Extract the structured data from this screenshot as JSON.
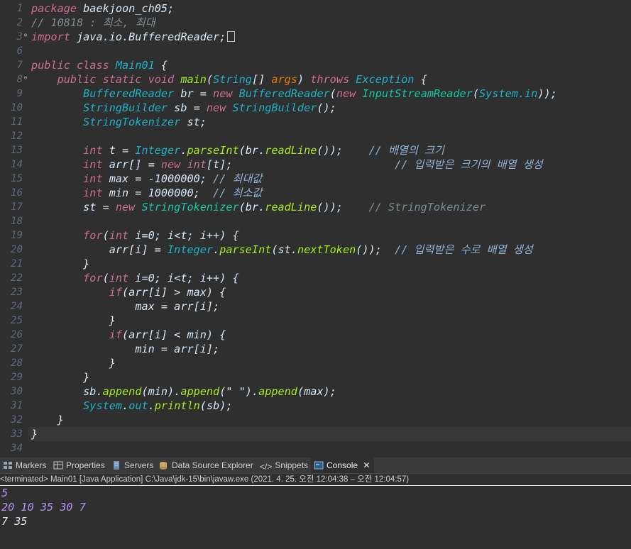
{
  "colors": {
    "background": "#2f2f2f",
    "keyword": "#cc6c93",
    "type": "#1fb2c6",
    "method": "#a7ec21",
    "comment": "#7d8c93",
    "input_text": "#b294f0",
    "output_text": "#d9e8f7"
  },
  "editor": {
    "line_numbers": [
      "1",
      "2",
      "3",
      "6",
      "7",
      "8",
      "9",
      "10",
      "11",
      "12",
      "13",
      "14",
      "15",
      "16",
      "17",
      "18",
      "19",
      "20",
      "21",
      "22",
      "23",
      "24",
      "25",
      "26",
      "27",
      "28",
      "29",
      "30",
      "31",
      "32",
      "33",
      "34"
    ],
    "lines": {
      "l1_kw": "package",
      "l1_rest": " baekjoon_ch05;",
      "l2": "// 10818 : 최소, 최대",
      "l3_kw": "import",
      "l3_rest": " java.io.BufferedReader;",
      "l7_kw1": "public",
      "l7_kw2": "class",
      "l7_name": "Main01",
      "l7_rest": " {",
      "l8_kw": "public static void",
      "l8_fn": "main",
      "l8_p1": "(",
      "l8_t1": "String",
      "l8_p2": "[] ",
      "l8_arg": "args",
      "l8_p3": ") ",
      "l8_throws": "throws",
      "l8_ex": "Exception",
      "l8_p4": " {",
      "l9_t": "BufferedReader",
      "l9_v": " br = ",
      "l9_new": "new",
      "l9_t2": "BufferedReader",
      "l9_p": "(",
      "l9_new2": "new",
      "l9_t3": "InputStreamReader",
      "l9_sys": "System",
      "l9_in": ".in",
      "l9_end": "));",
      "l10_t": "StringBuilder",
      "l10_v": " sb = ",
      "l10_new": "new",
      "l10_t2": "StringBuilder",
      "l10_end": "();",
      "l11_t": "StringTokenizer",
      "l11_v": " st;",
      "l13_int": "int",
      "l13_v": " t = ",
      "l13_t": "Integer",
      "l13_fn": "parseInt",
      "l13_br": "(br.",
      "l13_fn2": "readLine",
      "l13_end": "());",
      "l13_c": "// 배열의 크기",
      "l14_int": "int",
      "l14_v": " arr[] = ",
      "l14_new": "new",
      "l14_int2": "int",
      "l14_end": "[t];",
      "l14_c": "// 입력받은 크기의 배열 생성",
      "l15_int": "int",
      "l15_v": " max = -1000000; ",
      "l15_c": "// 최대값",
      "l16_int": "int",
      "l16_v": " min = 1000000;  ",
      "l16_c": "// 최소값",
      "l17_v": "st = ",
      "l17_new": "new",
      "l17_t": "StringTokenizer",
      "l17_br": "(br.",
      "l17_fn": "readLine",
      "l17_end": "());",
      "l17_c": "// StringTokenizer",
      "l19_for": "for",
      "l19_p": "(",
      "l19_int": "int",
      "l19_rest": " i=0; i<t; i++) {",
      "l20_v": "arr[i] = ",
      "l20_t": "Integer",
      "l20_fn": "parseInt",
      "l20_st": "(st.",
      "l20_fn2": "nextToken",
      "l20_end": "());  ",
      "l20_c": "// 입력받은 수로 배열 생성",
      "l21": "}",
      "l22_for": "for",
      "l22_p": "(",
      "l22_int": "int",
      "l22_rest": " i=0; i<t; i++) {",
      "l23_if": "if",
      "l23_rest": "(arr[i] > max) {",
      "l24": "max = arr[i];",
      "l25": "}",
      "l26_if": "if",
      "l26_rest": "(arr[i] < min) {",
      "l27": "min = arr[i];",
      "l28": "}",
      "l29": "}",
      "l30_v": "sb.",
      "l30_fn": "append",
      "l30_a": "(min).",
      "l30_fn2": "append",
      "l30_b": "(\" \").",
      "l30_fn3": "append",
      "l30_c": "(max);",
      "l31_sys": "System",
      "l31_dot": ".",
      "l31_out": "out",
      "l31_dot2": ".",
      "l31_fn": "println",
      "l31_end": "(sb);",
      "l32": "}",
      "l33": "}"
    }
  },
  "panel": {
    "tabs": [
      {
        "label": "Markers"
      },
      {
        "label": "Properties"
      },
      {
        "label": "Servers"
      },
      {
        "label": "Data Source Explorer"
      },
      {
        "label": "Snippets"
      },
      {
        "label": "Console"
      }
    ],
    "close_glyph": "✕",
    "status": "<terminated> Main01 [Java Application] C:\\Java\\jdk-15\\bin\\javaw.exe  (2021. 4. 25. 오전 12:04:38 – 오전 12:04:57)",
    "console_lines": [
      "5",
      "20 10 35 30 7",
      "7 35"
    ]
  }
}
